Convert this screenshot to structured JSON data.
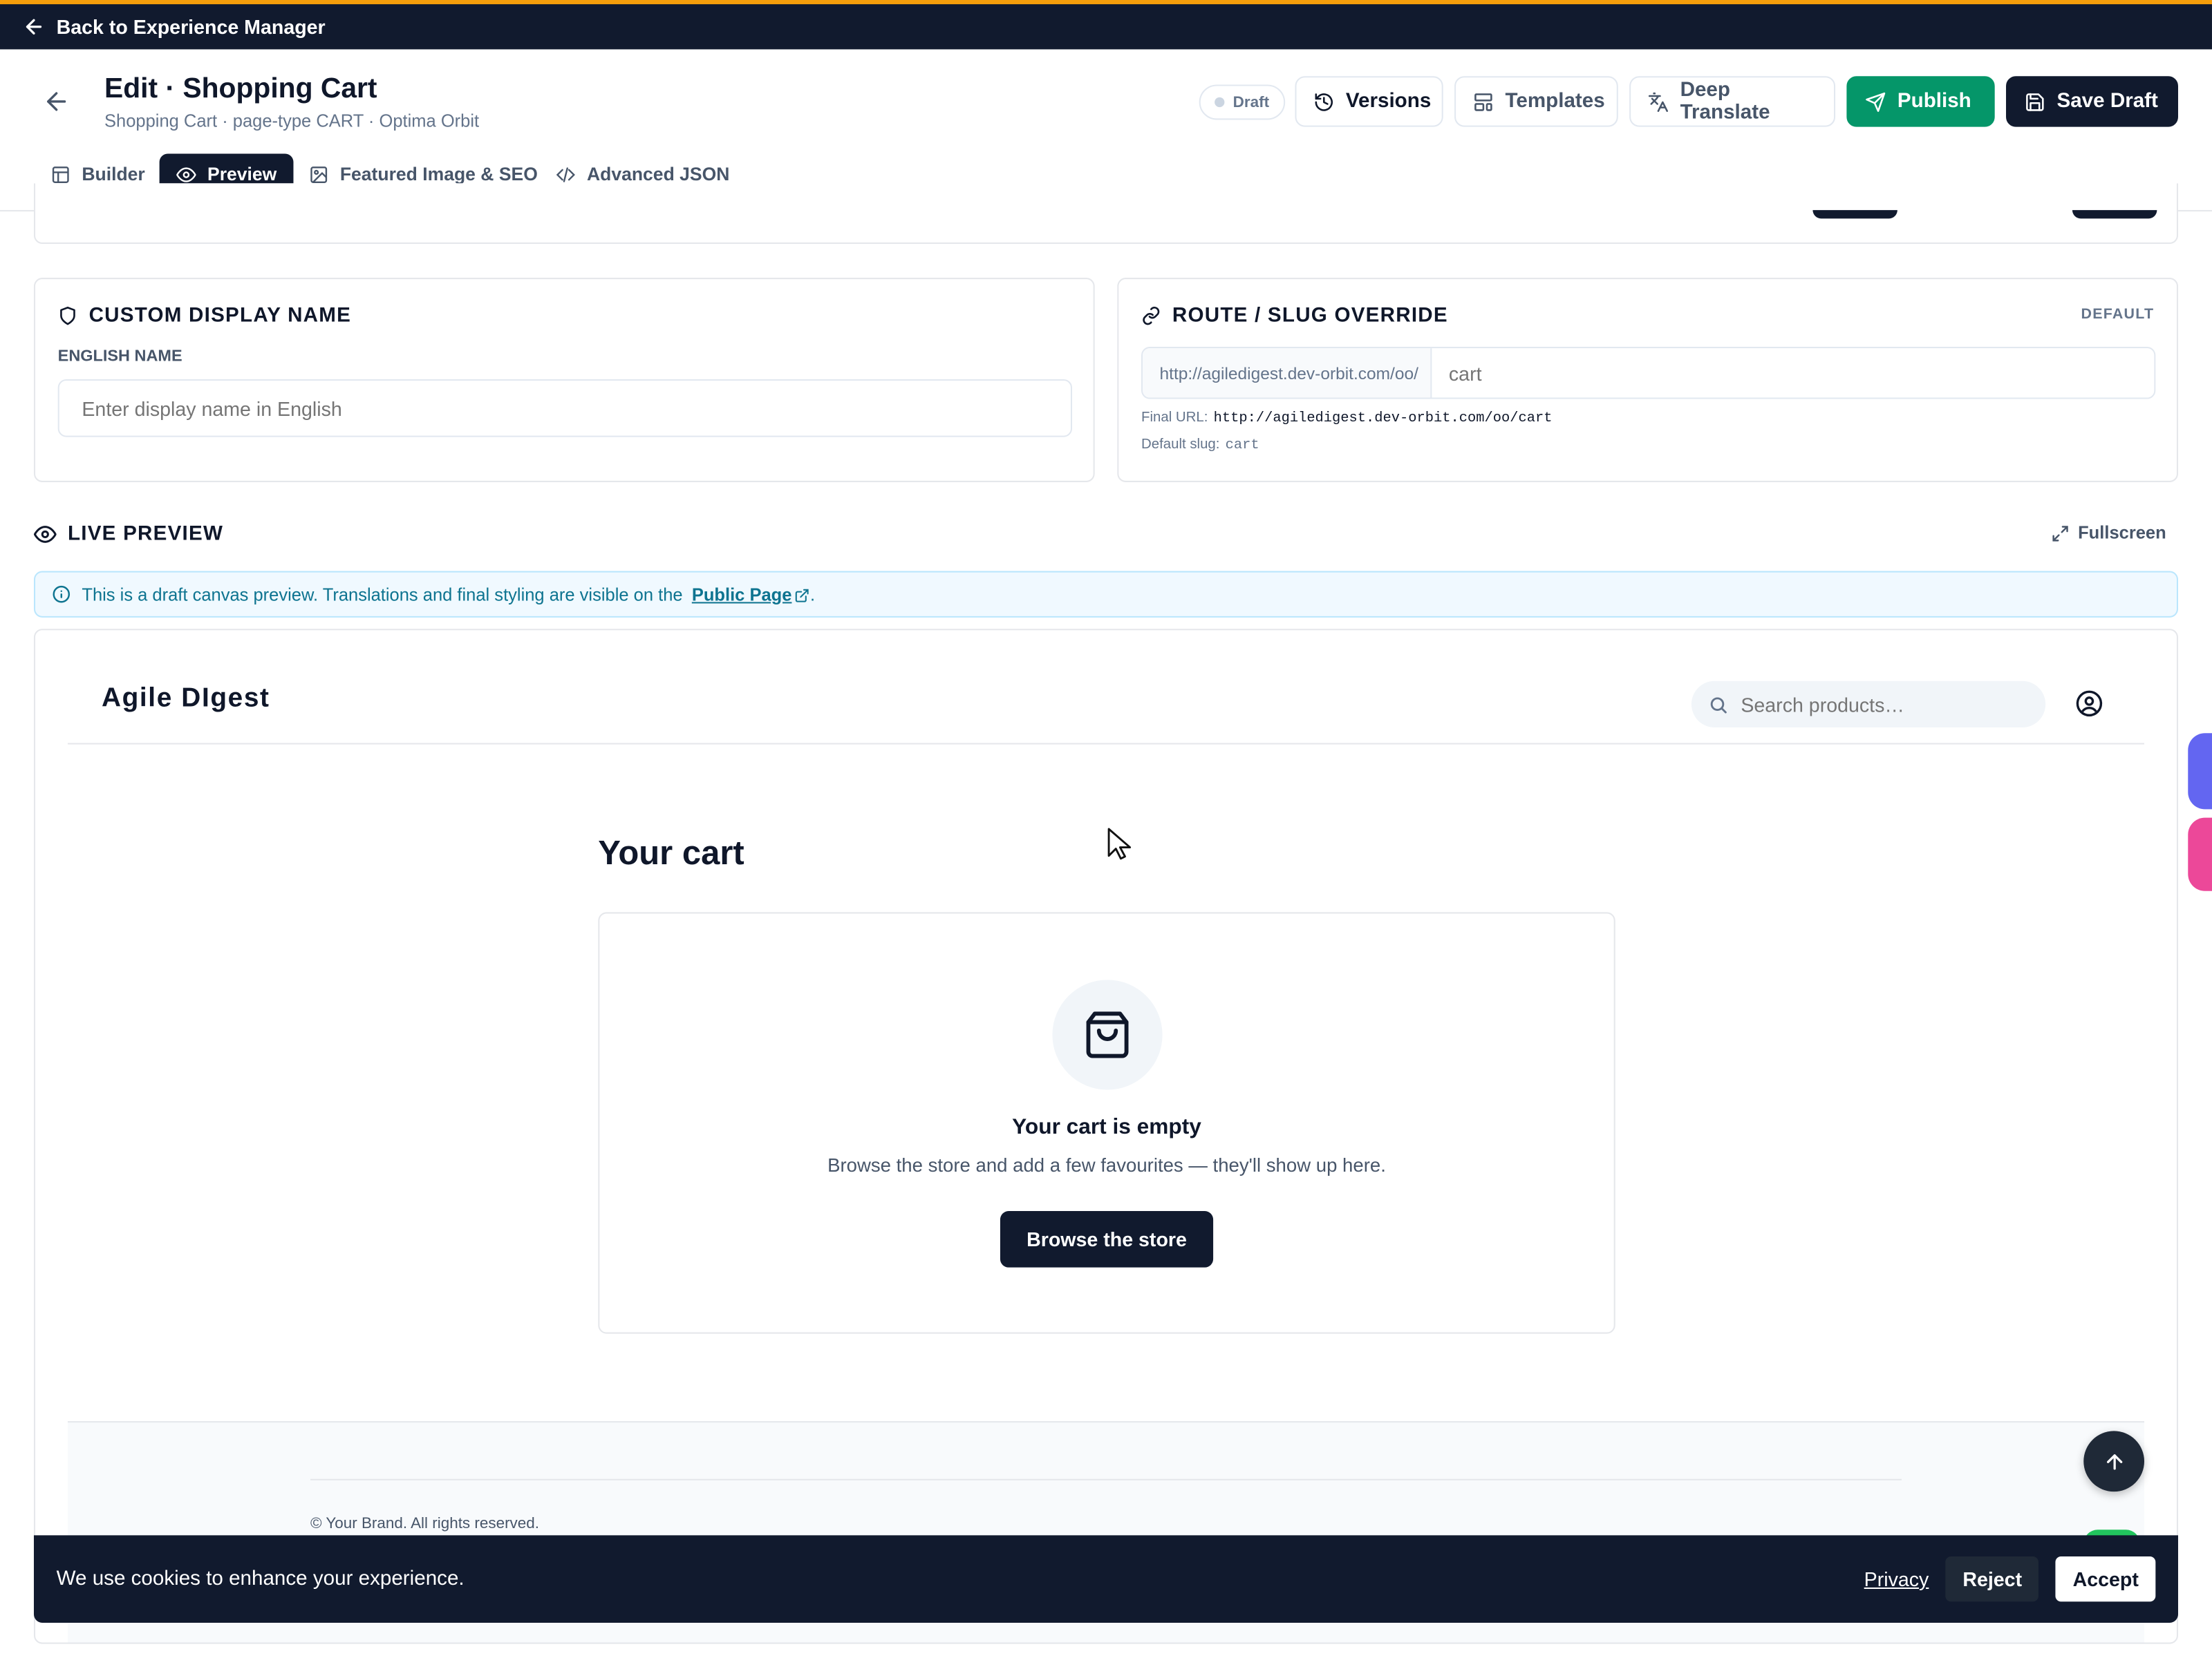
{
  "topbar": {
    "back_label": "Back to Experience Manager"
  },
  "header": {
    "title": "Edit · Shopping Cart",
    "subtitle": "Shopping Cart · page-type CART · Optima Orbit",
    "status_badge": "Draft",
    "buttons": {
      "versions": "Versions",
      "templates": "Templates",
      "deep_translate": "Deep Translate",
      "publish": "Publish",
      "save_draft": "Save Draft"
    }
  },
  "tabs": [
    {
      "label": "Builder",
      "active": false
    },
    {
      "label": "Preview",
      "active": true
    },
    {
      "label": "Featured Image & SEO",
      "active": false
    },
    {
      "label": "Advanced JSON",
      "active": false
    }
  ],
  "custom_name": {
    "title": "CUSTOM DISPLAY NAME",
    "field_label": "ENGLISH NAME",
    "placeholder": "Enter display name in English",
    "value": ""
  },
  "route": {
    "title": "ROUTE / SLUG OVERRIDE",
    "badge": "DEFAULT",
    "prefix": "http://agiledigest.dev-orbit.com/oo/",
    "slug_placeholder": "cart",
    "final_url_label": "Final URL:",
    "final_url": "http://agiledigest.dev-orbit.com/oo/cart",
    "default_slug_label": "Default slug:",
    "default_slug": "cart"
  },
  "live_preview": {
    "title": "LIVE PREVIEW",
    "fullscreen": "Fullscreen",
    "info_text": "This is a draft canvas preview. Translations and final styling are visible on the",
    "info_link": "Public Page",
    "info_end": "."
  },
  "store": {
    "brand": "Agile DIgest",
    "search_placeholder": "Search products…",
    "cart_heading": "Your cart",
    "empty_title": "Your cart is empty",
    "empty_text": "Browse the store and add a few favourites — they'll show up here.",
    "browse_button": "Browse the store",
    "footer_text": "© Your Brand. All rights reserved."
  },
  "cookie": {
    "message": "We use cookies to enhance your experience.",
    "privacy": "Privacy",
    "reject": "Reject",
    "accept": "Accept"
  },
  "colors": {
    "dark": "#111a2e",
    "publish_green": "#059669",
    "accent_amber": "#f59e0b",
    "info_blue": "#0e7490"
  }
}
